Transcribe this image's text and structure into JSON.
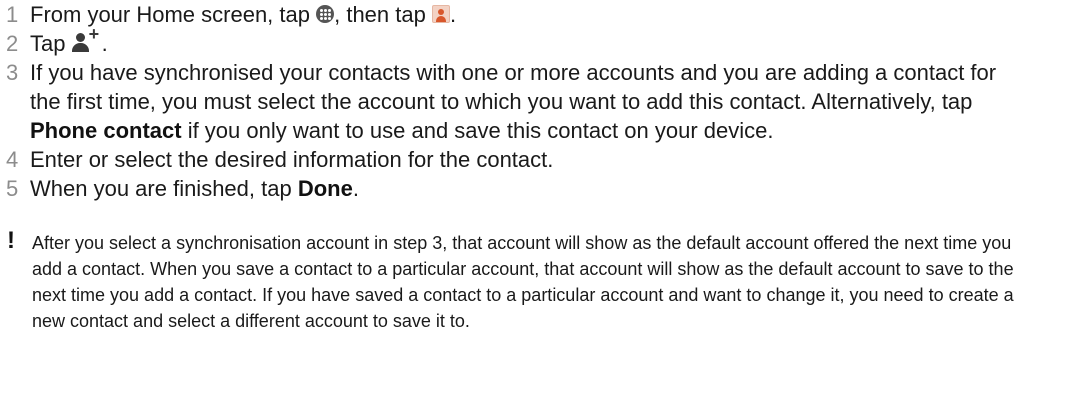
{
  "steps": [
    {
      "num": "1",
      "before": "From your Home screen, tap ",
      "mid": ", then tap ",
      "after": ".",
      "icon1": "apps-icon",
      "icon2": "contacts-app-icon"
    },
    {
      "num": "2",
      "before": "Tap ",
      "after": ".",
      "icon": "add-contact-icon"
    },
    {
      "num": "3",
      "before": "If you have synchronised your contacts with one or more accounts and you are adding a contact for the first time, you must select the account to which you want to add this contact. Alternatively, tap ",
      "bold": "Phone contact",
      "after": " if you only want to use and save this contact on your device."
    },
    {
      "num": "4",
      "text": "Enter or select the desired information for the contact."
    },
    {
      "num": "5",
      "before": "When you are finished, tap ",
      "bold": "Done",
      "after": "."
    }
  ],
  "note": {
    "icon": "exclamation-icon",
    "symbol": "!",
    "text": "After you select a synchronisation account in step 3, that account will show as the default account offered the next time you add a contact. When you save a contact to a particular account, that account will show as the default account to save to the next time you add a contact. If you have saved a contact to a particular account and want to change it, you need to create a new contact and select a different account to save it to."
  }
}
